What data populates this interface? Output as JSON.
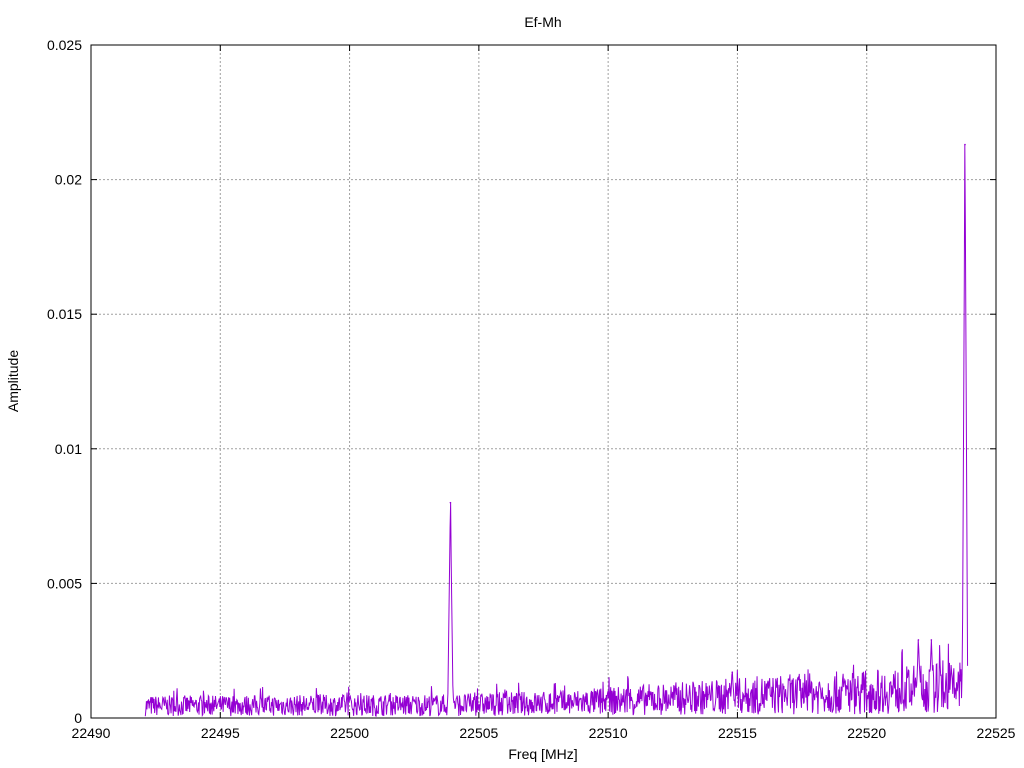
{
  "chart_data": {
    "type": "line",
    "title": "Ef-Mh",
    "xlabel": "Freq [MHz]",
    "ylabel": "Amplitude",
    "xlim": [
      22490,
      22525
    ],
    "ylim": [
      0,
      0.025
    ],
    "x_ticks": [
      22490,
      22495,
      22500,
      22505,
      22510,
      22515,
      22520,
      22525
    ],
    "y_ticks": [
      0,
      0.005,
      0.01,
      0.015,
      0.02,
      0.025
    ],
    "x_tick_labels": [
      "22490",
      "22495",
      "22500",
      "22505",
      "22510",
      "22515",
      "22520",
      "22525"
    ],
    "y_tick_labels": [
      "0",
      "0.005",
      "0.01",
      "0.015",
      "0.02",
      "0.025"
    ],
    "grid": true,
    "legend": "none",
    "series": [
      {
        "color": "#9400d3",
        "x_start": 22492.1,
        "x_end": 22523.9,
        "noise_envelope": [
          [
            22492.1,
            0.00045
          ],
          [
            22503.5,
            0.00048
          ],
          [
            22508.0,
            0.00055
          ],
          [
            22512.0,
            0.0007
          ],
          [
            22516.0,
            0.00085
          ],
          [
            22521.0,
            0.001
          ],
          [
            22523.8,
            0.0012
          ]
        ],
        "peaks": [
          {
            "x": 22503.9,
            "y": 0.008
          },
          {
            "x": 22514.8,
            "y": 0.0017
          },
          {
            "x": 22522.0,
            "y": 0.0029
          },
          {
            "x": 22522.5,
            "y": 0.0029
          },
          {
            "x": 22523.8,
            "y": 0.0213
          }
        ]
      }
    ]
  }
}
